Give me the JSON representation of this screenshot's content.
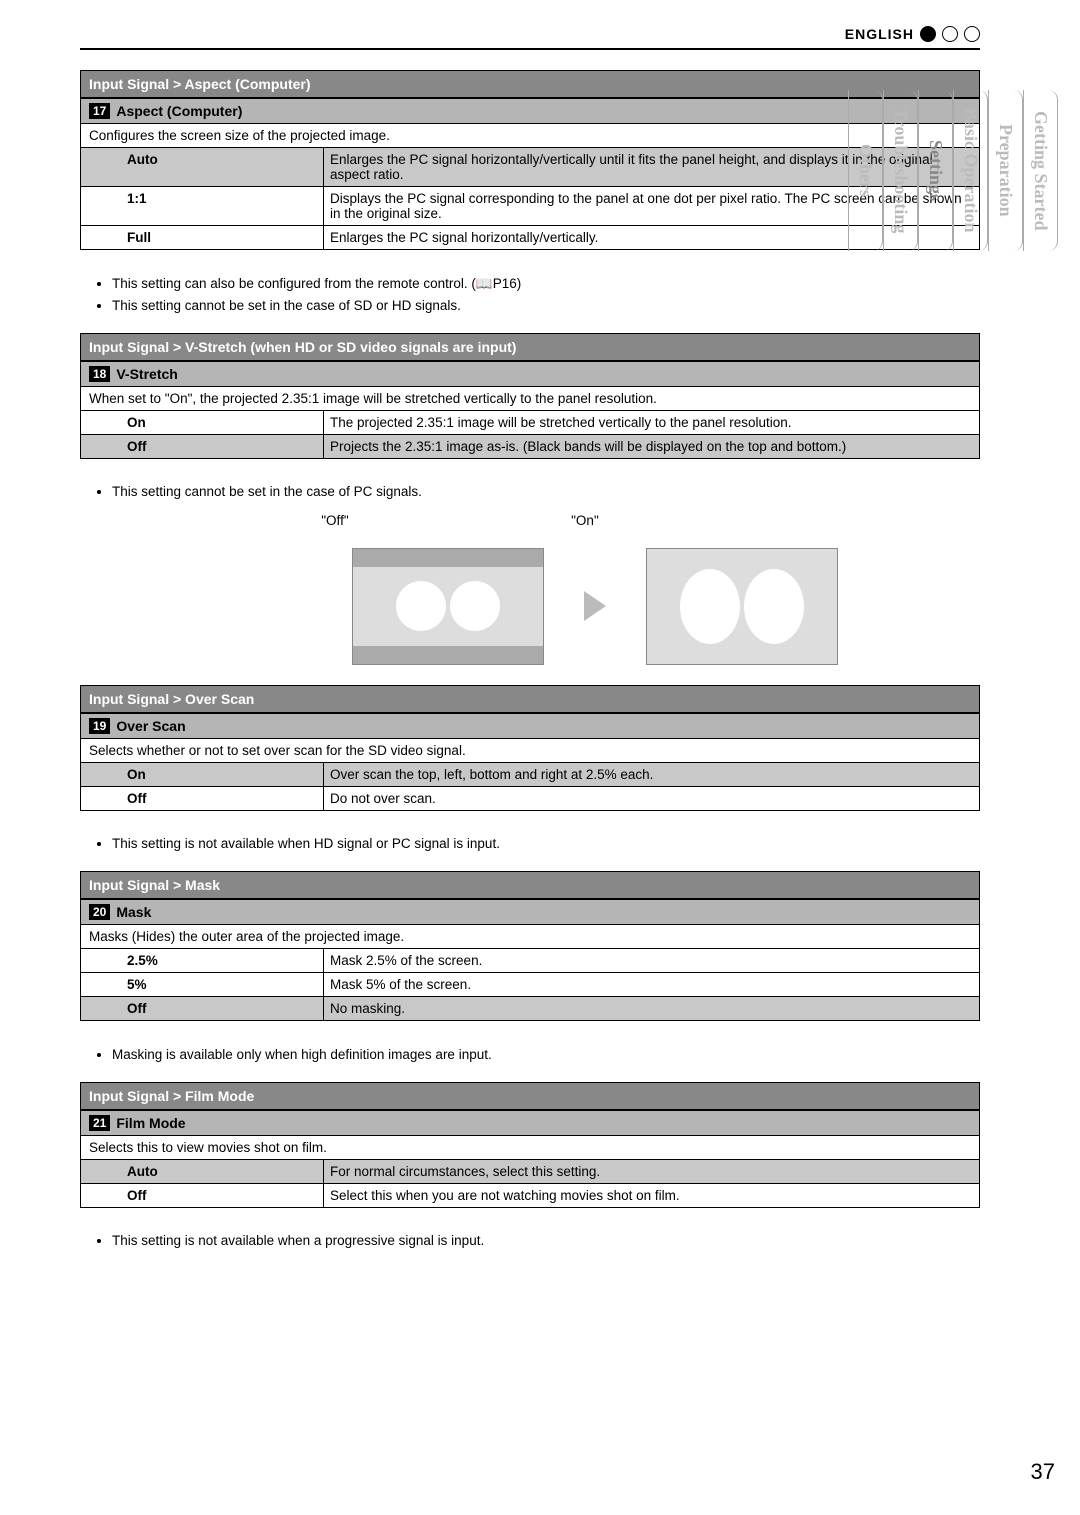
{
  "language": "ENGLISH",
  "side_tabs": [
    "Getting Started",
    "Preparation",
    "Basic Operation",
    "Settings",
    "Troubleshooting",
    "Others"
  ],
  "active_tab_index": 3,
  "page_number": "37",
  "sections": [
    {
      "breadcrumb": "Input Signal > Aspect (Computer)",
      "num": "17",
      "title": "Aspect (Computer)",
      "desc": "Configures the screen size of the projected image.",
      "rows": [
        {
          "shaded": true,
          "label": "Auto",
          "text": "Enlarges the PC signal horizontally/vertically until it fits the panel height, and displays it in the original aspect ratio."
        },
        {
          "shaded": false,
          "label": "1:1",
          "text": "Displays the PC signal corresponding to the panel at one dot per pixel ratio. The PC screen can be shown in the original size."
        },
        {
          "shaded": false,
          "label": "Full",
          "text": "Enlarges the PC signal horizontally/vertically."
        }
      ],
      "bullets": [
        "This setting can also be configured from the remote control. (📖P16)",
        "This setting cannot be set in the case of SD or HD signals."
      ]
    },
    {
      "breadcrumb": "Input Signal > V-Stretch (when HD or SD video signals are input)",
      "num": "18",
      "title": "V-Stretch",
      "desc": "When set to \"On\", the projected 2.35:1 image will be stretched vertically to the panel resolution.",
      "rows": [
        {
          "shaded": false,
          "label": "On",
          "text": "The projected 2.35:1 image will be stretched vertically to the panel resolution."
        },
        {
          "shaded": true,
          "label": "Off",
          "text": "Projects the 2.35:1 image as-is. (Black bands will be displayed on the top and bottom.)"
        }
      ],
      "bullets": [
        "This setting cannot be set in the case of PC signals."
      ],
      "diagram_labels": {
        "left": "\"Off\"",
        "right": "\"On\""
      }
    },
    {
      "breadcrumb": "Input Signal > Over Scan",
      "num": "19",
      "title": "Over Scan",
      "desc": "Selects whether or not to set over scan for the SD video signal.",
      "rows": [
        {
          "shaded": true,
          "label": "On",
          "text": "Over scan the top, left, bottom and right at 2.5% each."
        },
        {
          "shaded": false,
          "label": "Off",
          "text": "Do not over scan."
        }
      ],
      "bullets": [
        "This setting is not available when HD signal or PC signal is input."
      ]
    },
    {
      "breadcrumb": "Input Signal > Mask",
      "num": "20",
      "title": "Mask",
      "desc": "Masks (Hides) the outer area of the projected image.",
      "rows": [
        {
          "shaded": false,
          "label": "2.5%",
          "text": "Mask 2.5% of the screen."
        },
        {
          "shaded": false,
          "label": "5%",
          "text": "Mask 5% of the screen."
        },
        {
          "shaded": true,
          "label": "Off",
          "text": "No masking."
        }
      ],
      "bullets": [
        "Masking is available only when high definition images are input."
      ]
    },
    {
      "breadcrumb": "Input Signal > Film Mode",
      "num": "21",
      "title": "Film Mode",
      "desc": "Selects this to view movies shot on film.",
      "rows": [
        {
          "shaded": true,
          "label": "Auto",
          "text": "For normal circumstances, select this setting."
        },
        {
          "shaded": false,
          "label": "Off",
          "text": "Select this when you are not watching movies shot on film."
        }
      ],
      "bullets": [
        "This setting is not available when a progressive signal is input."
      ]
    }
  ]
}
